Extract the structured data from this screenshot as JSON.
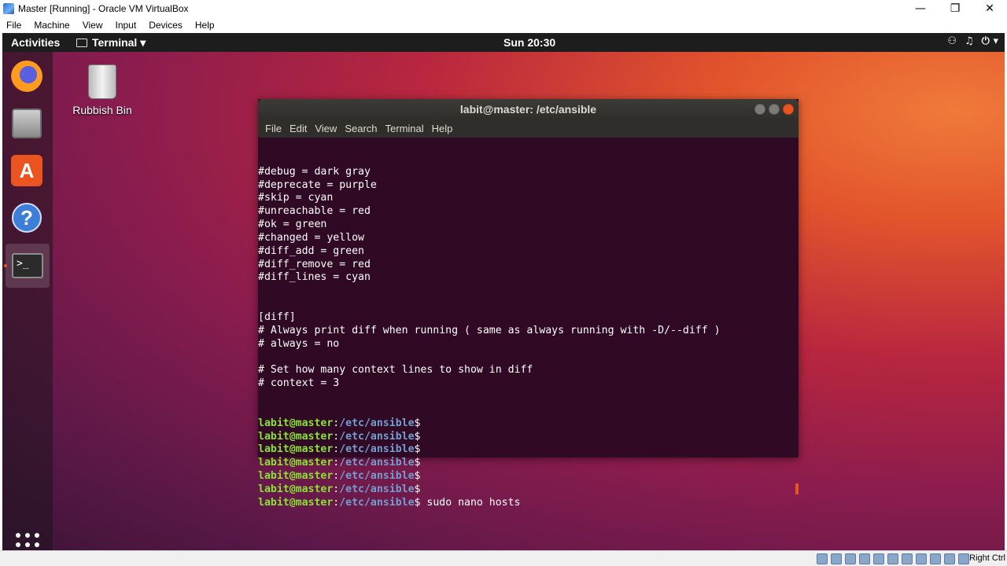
{
  "vbox": {
    "title": "Master [Running] - Oracle VM VirtualBox",
    "menu": [
      "File",
      "Machine",
      "View",
      "Input",
      "Devices",
      "Help"
    ],
    "host_key": "Right Ctrl",
    "controls": {
      "minimize": "—",
      "restore": "❐",
      "close": "✕"
    }
  },
  "topbar": {
    "activities": "Activities",
    "app_menu": "Terminal ▾",
    "clock": "Sun 20:30",
    "sys_icons": [
      "network-icon",
      "volume-icon",
      "power-icon"
    ]
  },
  "dock": {
    "items": [
      "firefox",
      "files",
      "ubuntu-software",
      "help",
      "terminal"
    ],
    "show_apps": "show-applications"
  },
  "desktop": {
    "trash_label": "Rubbish Bin"
  },
  "terminal": {
    "title": "labit@master: /etc/ansible",
    "menu": [
      "File",
      "Edit",
      "View",
      "Search",
      "Terminal",
      "Help"
    ],
    "text_lines": [
      "#debug = dark gray",
      "#deprecate = purple",
      "#skip = cyan",
      "#unreachable = red",
      "#ok = green",
      "#changed = yellow",
      "#diff_add = green",
      "#diff_remove = red",
      "#diff_lines = cyan",
      "",
      "",
      "[diff]",
      "# Always print diff when running ( same as always running with -D/--diff )",
      "# always = no",
      "",
      "# Set how many context lines to show in diff",
      "# context = 3"
    ],
    "prompt_user": "labit@master",
    "prompt_sep": ":",
    "prompt_path": "/etc/ansible",
    "prompt_symbol": "$",
    "prompt_commands": [
      "",
      "",
      "",
      "",
      "",
      "",
      " sudo nano hosts"
    ]
  }
}
